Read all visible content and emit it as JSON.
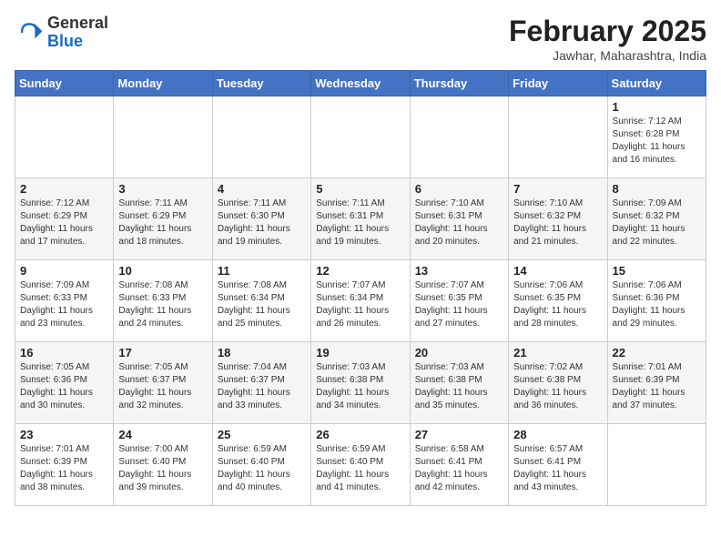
{
  "header": {
    "logo": {
      "general": "General",
      "blue": "Blue"
    },
    "title": "February 2025",
    "subtitle": "Jawhar, Maharashtra, India"
  },
  "days_of_week": [
    "Sunday",
    "Monday",
    "Tuesday",
    "Wednesday",
    "Thursday",
    "Friday",
    "Saturday"
  ],
  "weeks": [
    [
      {
        "day": "",
        "info": ""
      },
      {
        "day": "",
        "info": ""
      },
      {
        "day": "",
        "info": ""
      },
      {
        "day": "",
        "info": ""
      },
      {
        "day": "",
        "info": ""
      },
      {
        "day": "",
        "info": ""
      },
      {
        "day": "1",
        "info": "Sunrise: 7:12 AM\nSunset: 6:28 PM\nDaylight: 11 hours\nand 16 minutes."
      }
    ],
    [
      {
        "day": "2",
        "info": "Sunrise: 7:12 AM\nSunset: 6:29 PM\nDaylight: 11 hours\nand 17 minutes."
      },
      {
        "day": "3",
        "info": "Sunrise: 7:11 AM\nSunset: 6:29 PM\nDaylight: 11 hours\nand 18 minutes."
      },
      {
        "day": "4",
        "info": "Sunrise: 7:11 AM\nSunset: 6:30 PM\nDaylight: 11 hours\nand 19 minutes."
      },
      {
        "day": "5",
        "info": "Sunrise: 7:11 AM\nSunset: 6:31 PM\nDaylight: 11 hours\nand 19 minutes."
      },
      {
        "day": "6",
        "info": "Sunrise: 7:10 AM\nSunset: 6:31 PM\nDaylight: 11 hours\nand 20 minutes."
      },
      {
        "day": "7",
        "info": "Sunrise: 7:10 AM\nSunset: 6:32 PM\nDaylight: 11 hours\nand 21 minutes."
      },
      {
        "day": "8",
        "info": "Sunrise: 7:09 AM\nSunset: 6:32 PM\nDaylight: 11 hours\nand 22 minutes."
      }
    ],
    [
      {
        "day": "9",
        "info": "Sunrise: 7:09 AM\nSunset: 6:33 PM\nDaylight: 11 hours\nand 23 minutes."
      },
      {
        "day": "10",
        "info": "Sunrise: 7:08 AM\nSunset: 6:33 PM\nDaylight: 11 hours\nand 24 minutes."
      },
      {
        "day": "11",
        "info": "Sunrise: 7:08 AM\nSunset: 6:34 PM\nDaylight: 11 hours\nand 25 minutes."
      },
      {
        "day": "12",
        "info": "Sunrise: 7:07 AM\nSunset: 6:34 PM\nDaylight: 11 hours\nand 26 minutes."
      },
      {
        "day": "13",
        "info": "Sunrise: 7:07 AM\nSunset: 6:35 PM\nDaylight: 11 hours\nand 27 minutes."
      },
      {
        "day": "14",
        "info": "Sunrise: 7:06 AM\nSunset: 6:35 PM\nDaylight: 11 hours\nand 28 minutes."
      },
      {
        "day": "15",
        "info": "Sunrise: 7:06 AM\nSunset: 6:36 PM\nDaylight: 11 hours\nand 29 minutes."
      }
    ],
    [
      {
        "day": "16",
        "info": "Sunrise: 7:05 AM\nSunset: 6:36 PM\nDaylight: 11 hours\nand 30 minutes."
      },
      {
        "day": "17",
        "info": "Sunrise: 7:05 AM\nSunset: 6:37 PM\nDaylight: 11 hours\nand 32 minutes."
      },
      {
        "day": "18",
        "info": "Sunrise: 7:04 AM\nSunset: 6:37 PM\nDaylight: 11 hours\nand 33 minutes."
      },
      {
        "day": "19",
        "info": "Sunrise: 7:03 AM\nSunset: 6:38 PM\nDaylight: 11 hours\nand 34 minutes."
      },
      {
        "day": "20",
        "info": "Sunrise: 7:03 AM\nSunset: 6:38 PM\nDaylight: 11 hours\nand 35 minutes."
      },
      {
        "day": "21",
        "info": "Sunrise: 7:02 AM\nSunset: 6:38 PM\nDaylight: 11 hours\nand 36 minutes."
      },
      {
        "day": "22",
        "info": "Sunrise: 7:01 AM\nSunset: 6:39 PM\nDaylight: 11 hours\nand 37 minutes."
      }
    ],
    [
      {
        "day": "23",
        "info": "Sunrise: 7:01 AM\nSunset: 6:39 PM\nDaylight: 11 hours\nand 38 minutes."
      },
      {
        "day": "24",
        "info": "Sunrise: 7:00 AM\nSunset: 6:40 PM\nDaylight: 11 hours\nand 39 minutes."
      },
      {
        "day": "25",
        "info": "Sunrise: 6:59 AM\nSunset: 6:40 PM\nDaylight: 11 hours\nand 40 minutes."
      },
      {
        "day": "26",
        "info": "Sunrise: 6:59 AM\nSunset: 6:40 PM\nDaylight: 11 hours\nand 41 minutes."
      },
      {
        "day": "27",
        "info": "Sunrise: 6:58 AM\nSunset: 6:41 PM\nDaylight: 11 hours\nand 42 minutes."
      },
      {
        "day": "28",
        "info": "Sunrise: 6:57 AM\nSunset: 6:41 PM\nDaylight: 11 hours\nand 43 minutes."
      },
      {
        "day": "",
        "info": ""
      }
    ]
  ]
}
